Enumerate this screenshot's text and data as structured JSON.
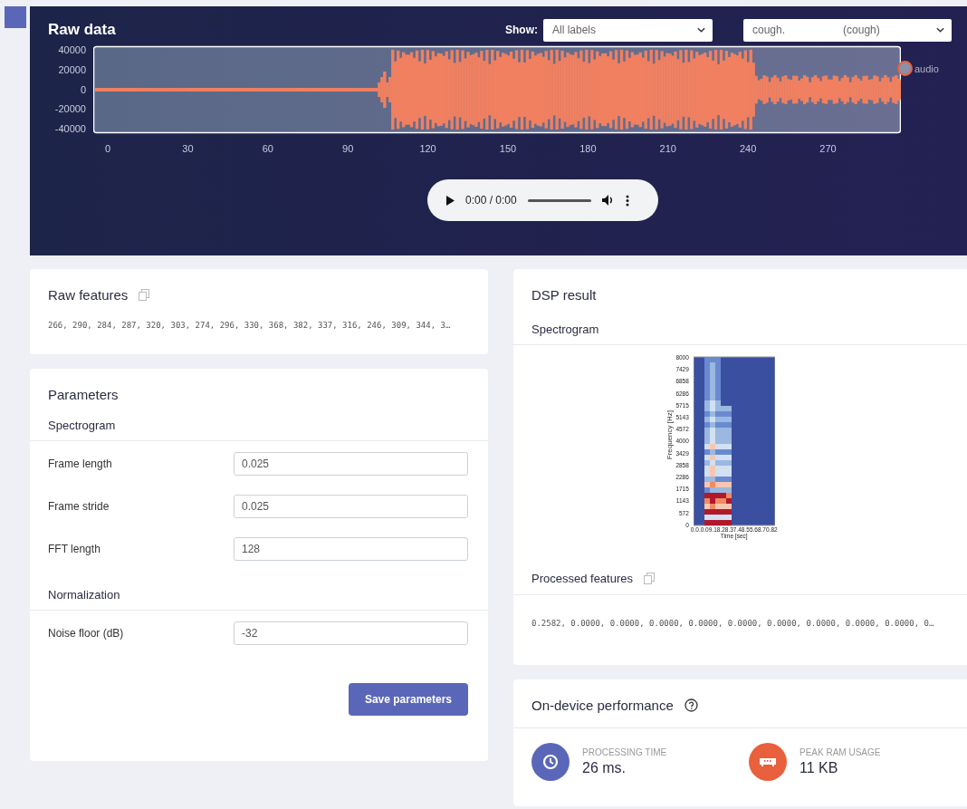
{
  "raw_data": {
    "title": "Raw data",
    "show_label": "Show:",
    "show_select": {
      "value": "All labels"
    },
    "sample_select": {
      "value": "cough.",
      "suffix": "(cough)"
    },
    "waveform": {
      "y_ticks": [
        "40000",
        "20000",
        "0",
        "-20000",
        "-40000"
      ],
      "x_ticks": [
        "0",
        "30",
        "60",
        "90",
        "120",
        "150",
        "180",
        "210",
        "240",
        "270"
      ],
      "legend": "audio"
    },
    "player": {
      "time": "0:00 / 0:00"
    }
  },
  "raw_features": {
    "title": "Raw features",
    "values": "266, 290, 284, 287, 320, 303, 274, 296, 330, 368, 382, 337, 316, 246, 309, 344, 3…"
  },
  "parameters": {
    "title": "Parameters",
    "sections": [
      {
        "title": "Spectrogram",
        "fields": [
          {
            "label": "Frame length",
            "value": "0.025"
          },
          {
            "label": "Frame stride",
            "value": "0.025"
          },
          {
            "label": "FFT length",
            "value": "128"
          }
        ]
      },
      {
        "title": "Normalization",
        "fields": [
          {
            "label": "Noise floor (dB)",
            "value": "-32"
          }
        ]
      }
    ],
    "save_button": "Save parameters"
  },
  "dsp_result": {
    "title": "DSP result",
    "spectrogram_title": "Spectrogram",
    "spectrogram": {
      "y_ticks": [
        "8000",
        "7429",
        "6858",
        "6286",
        "5715",
        "5143",
        "4572",
        "4000",
        "3429",
        "2858",
        "2286",
        "1715",
        "1143",
        "572",
        "0"
      ],
      "y_label": "Frequency [Hz]",
      "x_ticks": "0.0.0.09.18.28.37.48.55.68.70.82",
      "x_label": "Time [sec]"
    },
    "processed_title": "Processed features",
    "processed_values": "0.2582, 0.0000, 0.0000, 0.0000, 0.0000, 0.0000, 0.0000, 0.0000, 0.0000, 0.0000, 0…"
  },
  "performance": {
    "title": "On-device performance",
    "metrics": [
      {
        "kind": "time",
        "label": "PROCESSING TIME",
        "value": "26 ms.",
        "color": "#5a67b8"
      },
      {
        "kind": "ram",
        "label": "PEAK RAM USAGE",
        "value": "11 KB",
        "color": "#e8603c"
      }
    ]
  }
}
